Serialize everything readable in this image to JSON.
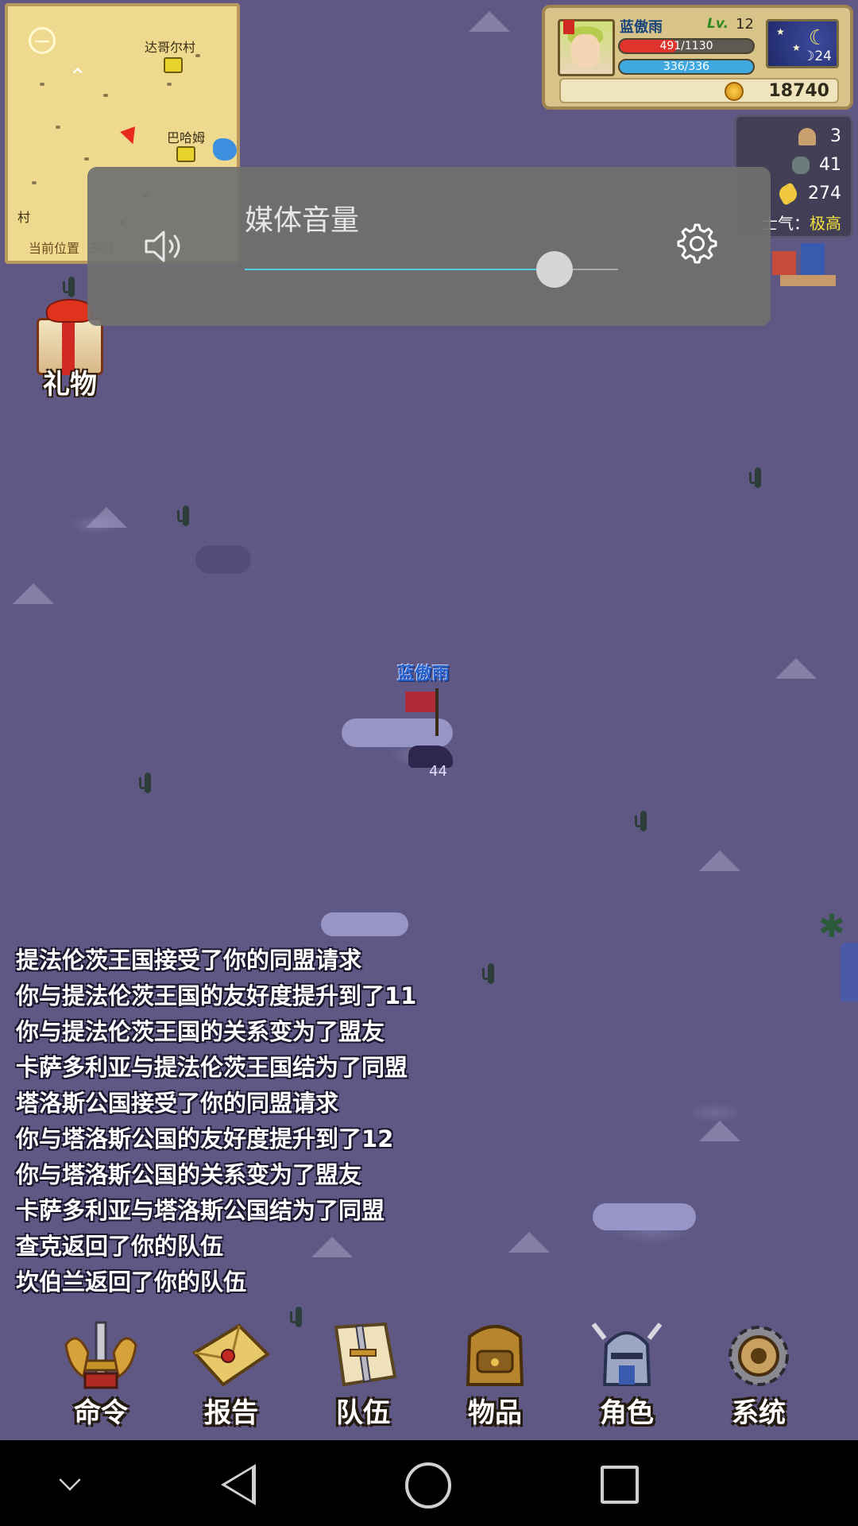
{
  "minimap": {
    "places": [
      "达哥尔村",
      "巴哈姆",
      "村"
    ],
    "current_position_label": "当前位置",
    "coords": "303"
  },
  "player": {
    "name": "蓝傲雨",
    "level_label": "Lv.",
    "level": "12",
    "hp_text": "491/1130",
    "hp_fraction": 0.434,
    "mp_text": "336/336",
    "mp_fraction": 1.0,
    "day": "24",
    "gold": "18740"
  },
  "army": {
    "heroes": "3",
    "soldiers": "41",
    "food": "274",
    "morale_label": "士气：",
    "morale_value": "极高"
  },
  "gift": {
    "label": "礼物"
  },
  "map_unit": {
    "name": "蓝傲雨",
    "troops": "44"
  },
  "messages": [
    "提法伦茨王国接受了你的同盟请求",
    "你与提法伦茨王国的友好度提升到了11",
    "你与提法伦茨王国的关系变为了盟友",
    "卡萨多利亚与提法伦茨王国结为了同盟",
    "塔洛斯公国接受了你的同盟请求",
    "你与塔洛斯公国的友好度提升到了12",
    "你与塔洛斯公国的关系变为了盟友",
    "卡萨多利亚与塔洛斯公国结为了同盟",
    "查克返回了你的队伍",
    "坎伯兰返回了你的队伍"
  ],
  "menu": {
    "command": "命令",
    "report": "报告",
    "party": "队伍",
    "items": "物品",
    "character": "角色",
    "system": "系统"
  },
  "volume": {
    "title": "媒体音量",
    "level": 0.83
  },
  "colors": {
    "map_bg": "#5f5884",
    "hp": "#e0332b",
    "mp": "#3ea8df",
    "slider_accent": "#4fd0e2",
    "morale_value": "#f4e23a"
  },
  "icons": {
    "volume": "speaker-icon",
    "settings": "gear-icon",
    "nav": [
      "chevron-down-icon",
      "back-icon",
      "home-icon",
      "recents-icon"
    ]
  }
}
